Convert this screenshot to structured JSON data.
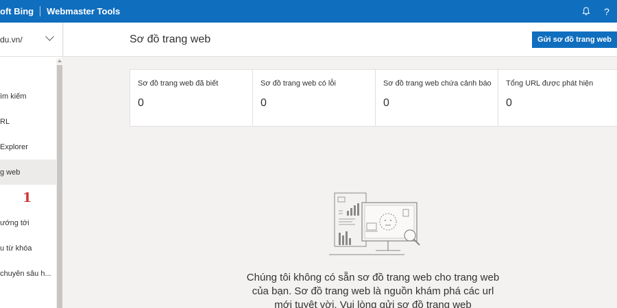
{
  "topbar": {
    "brand_name": "oft Bing",
    "product_name": "Webmaster Tools",
    "bell_icon_glyph": "🔔",
    "help_icon_glyph": "?"
  },
  "sidebar": {
    "site_name": "du.vn/",
    "marker": "1",
    "items": [
      {
        "label": "ìm kiếm"
      },
      {
        "label": "RL"
      },
      {
        "label": " Explorer"
      },
      {
        "label": "g web"
      },
      {
        "label": "ướng tới"
      },
      {
        "label": "u từ khóa"
      },
      {
        "label": "chuyên sâu h..."
      }
    ]
  },
  "header": {
    "title": "Sơ đồ trang web",
    "submit_label": "Gửi sơ đồ trang web"
  },
  "stats": [
    {
      "label": "Sơ đồ trang web đã biết",
      "value": "0"
    },
    {
      "label": "Sơ đồ trang web có lỗi",
      "value": "0"
    },
    {
      "label": "Sơ đồ trang web chứa cảnh báo",
      "value": "0"
    },
    {
      "label": "Tổng URL được phát hiện",
      "value": "0"
    }
  ],
  "empty_state": {
    "message": "Chúng tôi không có sẵn sơ đồ trang web cho trang web của bạn. Sơ đồ trang web là nguồn khám phá các url mới tuyệt vời. Vui lòng gửi sơ đồ trang web"
  },
  "colors": {
    "accent": "#106ebe",
    "marker": "#d13438"
  }
}
